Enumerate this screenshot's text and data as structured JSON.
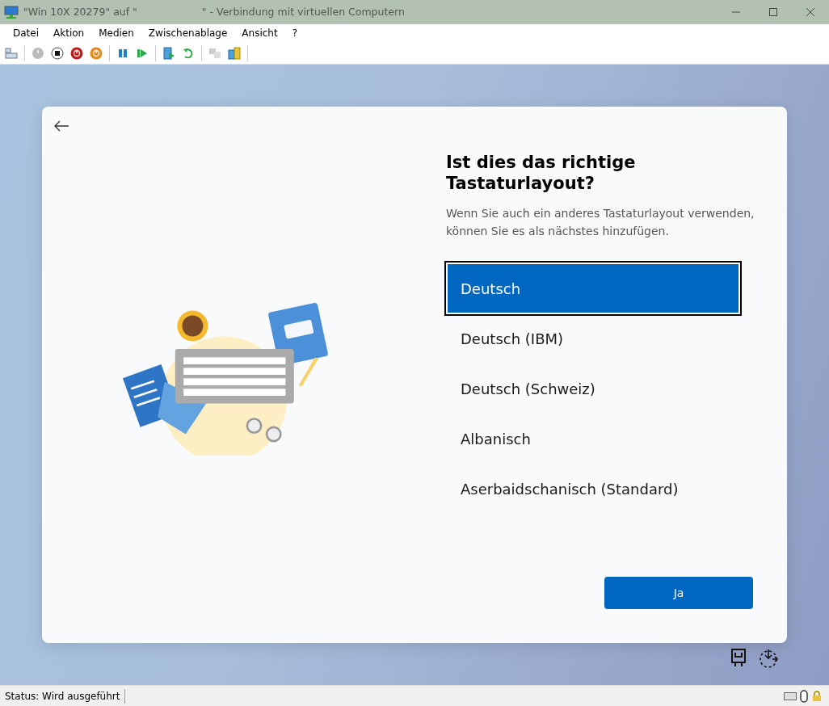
{
  "window": {
    "title_left": "\"Win 10X 20279\" auf \"",
    "title_right": "\" - Verbindung mit virtuellen Computern"
  },
  "menu": [
    "Datei",
    "Aktion",
    "Medien",
    "Zwischenablage",
    "Ansicht",
    "?"
  ],
  "setup": {
    "heading": "Ist dies das richtige Tastaturlayout?",
    "description": "Wenn Sie auch ein anderes Tastaturlayout verwenden, können Sie es als nächstes hinzufügen.",
    "layouts": [
      {
        "label": "Deutsch",
        "selected": true
      },
      {
        "label": "Deutsch (IBM)",
        "selected": false
      },
      {
        "label": "Deutsch (Schweiz)",
        "selected": false
      },
      {
        "label": "Albanisch",
        "selected": false
      },
      {
        "label": "Aserbaidschanisch (Standard)",
        "selected": false
      }
    ],
    "confirm_button": "Ja"
  },
  "status_bar": {
    "text": "Status: Wird ausgeführt"
  }
}
